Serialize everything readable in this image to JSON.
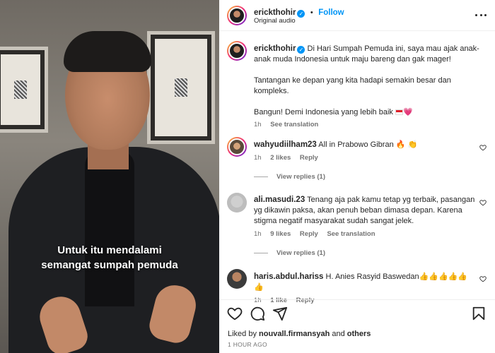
{
  "media": {
    "caption_line1": "Untuk itu mendalami",
    "caption_line2": "semangat sumpah pemuda"
  },
  "header": {
    "username": "erickthohir",
    "follow_label": "Follow",
    "audio": "Original audio"
  },
  "post": {
    "username": "erickthohir",
    "caption_p1": "Di Hari Sumpah Pemuda ini, saya mau ajak anak-anak muda Indonesia untuk maju bareng dan gak mager!",
    "caption_p2": "Tantangan ke depan yang kita hadapi semakin besar dan kompleks.",
    "caption_p3": "Bangun! Demi Indonesia yang lebih baik",
    "emoji_heart": "💗",
    "time": "1h",
    "translate": "See translation"
  },
  "comments": [
    {
      "username": "wahyudiilham23",
      "text": "All in Prabowo Gibran",
      "emoji": "🔥 👏",
      "time": "1h",
      "likes": "2 likes",
      "reply": "Reply",
      "view_replies": "View replies (1)"
    },
    {
      "username": "ali.masudi.23",
      "text": "Tenang aja pak kamu tetap yg terbaik, pasangan yg dikawin paksa, akan penuh beban dimasa depan. Karena stigma negatif masyarakat sudah sangat jelek.",
      "time": "1h",
      "likes": "9 likes",
      "reply": "Reply",
      "translate": "See translation",
      "view_replies": "View replies (1)"
    },
    {
      "username": "haris.abdul.hariss",
      "text": "H. Anies Rasyid Baswedan",
      "emoji": "👍👍👍👍👍👍",
      "time": "1h",
      "likes": "1 like",
      "reply": "Reply"
    }
  ],
  "footer": {
    "liked_by_prefix": "Liked by",
    "liked_by_user": "nouvall.firmansyah",
    "liked_by_and": "and",
    "liked_by_others": "others",
    "timestamp": "1 HOUR AGO"
  },
  "icons": {
    "like": "heart-icon",
    "comment": "comment-icon",
    "share": "share-icon",
    "save": "bookmark-icon",
    "verified": "verified-badge-icon",
    "more": "more-options-icon"
  },
  "colors": {
    "accent": "#0095f6",
    "text": "#262626",
    "muted": "#737373"
  }
}
